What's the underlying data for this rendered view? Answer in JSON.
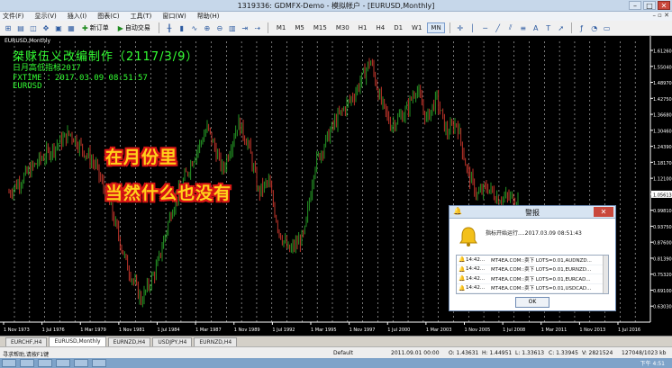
{
  "window": {
    "title": "1319336: GDMFX-Demo - 模拟帐户 - [EURUSD,Monthly]",
    "min": "–",
    "max": "□",
    "close": "✕"
  },
  "menu": [
    "文件(F)",
    "显示(V)",
    "插入(I)",
    "图表(C)",
    "工具(T)",
    "窗口(W)",
    "帮助(H)"
  ],
  "toolbar": {
    "new_order": "新订单",
    "auto_trade": "自动交易",
    "timeframes": [
      "M1",
      "M5",
      "M15",
      "M30",
      "H1",
      "H4",
      "D1",
      "W1",
      "MN"
    ],
    "active_timeframe": "MN"
  },
  "chart": {
    "symbol_label": "EURUSD,Monthly",
    "info_lines": [
      "桀赇伍义改编制作（2117/3/9）",
      "日月高低指标2017",
      "FXTIME ：2017.03.09 08:51:57",
      "EURUSD"
    ],
    "overlay_lines": [
      "在月份里",
      "当然什么也没有"
    ],
    "current_price": "1.05613",
    "text_color": "#33ff33",
    "bull_color": "#2aa52a",
    "bear_color": "#d43a2f"
  },
  "chart_data": {
    "type": "candlestick",
    "y_ticks": [
      "1.61260",
      "1.55040",
      "1.48970",
      "1.42750",
      "1.36680",
      "1.30460",
      "1.24390",
      "1.18170",
      "1.12100",
      "1.05613",
      "0.99810",
      "0.93750",
      "0.87600",
      "0.81390",
      "0.75320",
      "0.69100",
      "0.63030"
    ],
    "x_ticks": [
      "1 Nov 1973",
      "1 Jul 1976",
      "1 Mar 1979",
      "1 Nov 1981",
      "1 Jul 1984",
      "1 Mar 1987",
      "1 Nov 1989",
      "1 Jul 1992",
      "1 Mar 1995",
      "1 Nov 1997",
      "1 Jul 2000",
      "1 Mar 2003",
      "1 Nov 2005",
      "1 Jul 2008",
      "1 Mar 2011",
      "1 Nov 2013",
      "1 Jul 2016"
    ],
    "ylim": [
      0.6,
      1.64
    ],
    "grid": true
  },
  "alert": {
    "title": "警报",
    "message": "指标开始运行....2017.03.09 08:51:43",
    "rows": [
      {
        "time": "14:42...",
        "text": "MT4EA.COM::卖下 LOTS=0.01,AUDNZD..."
      },
      {
        "time": "14:42...",
        "text": "MT4EA.COM::卖下 LOTS=0.01,EURNZD..."
      },
      {
        "time": "14:42...",
        "text": "MT4EA.COM::卖下 LOTS=0.01,EURCAD..."
      },
      {
        "time": "14:42...",
        "text": "MT4EA.COM::卖下 LOTS=0.01,USDCAD..."
      }
    ],
    "ok_label": "OK"
  },
  "tabs": [
    "EURCHF,H4",
    "EURUSD,Monthly",
    "EURNZD,H4",
    "USDJPY,H4",
    "EURNZD,H4"
  ],
  "active_tab": "EURUSD,Monthly",
  "status": {
    "help": "寻求帮助,请按F1键",
    "profile": "Default",
    "datetime": "2011.09.01 00:00",
    "open": "O: 1.43631",
    "high": "H: 1.44951",
    "low": "L: 1.33613",
    "close": "C: 1.33945",
    "volume": "V: 2821524",
    "traffic": "127048/1023 kb"
  },
  "taskbar": {
    "clock": "下午 4:51"
  }
}
